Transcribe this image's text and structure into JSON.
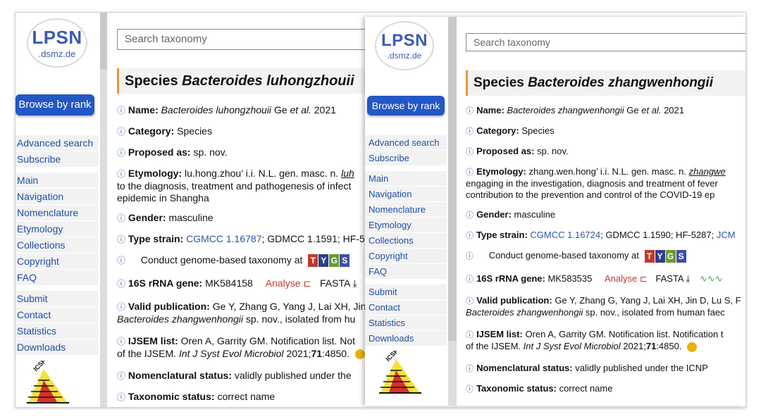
{
  "logo": {
    "name": "LPSN",
    "domain": ".dsmz.de"
  },
  "sidebar": {
    "browse_button": "Browse by rank",
    "items": [
      "Advanced search",
      "Subscribe",
      "Main",
      "Navigation",
      "Nomenclature",
      "Etymology",
      "Collections",
      "Copyright",
      "FAQ",
      "Submit",
      "Contact",
      "Statistics",
      "Downloads"
    ]
  },
  "search": {
    "placeholder": "Search taxonomy"
  },
  "colors": {
    "accent_orange": "#e5963a",
    "link_blue": "#2c56a8",
    "button_blue": "#2257c5",
    "analyse_red": "#c0392b"
  },
  "left": {
    "title_prefix": "Species",
    "title_name": "Bacteroides luhongzhouii",
    "name_label": "Name:",
    "name_value": "Bacteroides luhongzhouii",
    "name_author": "Ge",
    "name_etal": "et al.",
    "name_year": "2021",
    "category_label": "Category:",
    "category_value": "Species",
    "proposed_label": "Proposed as:",
    "proposed_value": "sp. nov.",
    "etymology_label": "Etymology:",
    "etymology_text": "lu.hong.zhou’ i.i. N.L. gen. masc. n.",
    "etymology_trunc": "luh",
    "etymology_line2": "to the diagnosis, treatment and pathogenesis of infect",
    "etymology_line3": "epidemic in Shangha",
    "gender_label": "Gender:",
    "gender_value": "masculine",
    "type_strain_label": "Type strain:",
    "type_strain_link": "CGMCC 1.16787",
    "type_strain_rest": "; GDMCC 1.1591; HF-5",
    "genome_text": "Conduct genome-based taxonomy at",
    "rrna_label": "16S rRNA gene:",
    "rrna_value": "MK584158",
    "analyse": "Analyse",
    "fasta": "FASTA",
    "valid_label": "Valid publication:",
    "valid_text": "Ge Y, Zhang G, Yang J, Lai XH, Jin",
    "valid_line2_species": "Bacteroides zhangwenhongii",
    "valid_line2_rest": "sp. nov., isolated from hu",
    "ijsem_label": "IJSEM list:",
    "ijsem_text": "Oren A, Garrity GM. Notification list. Not",
    "ijsem_line2a": "of the IJSEM.",
    "ijsem_journal": "Int J Syst Evol Microbiol",
    "ijsem_year": "2021;",
    "ijsem_vol": "71",
    "ijsem_pages": ":4850.",
    "nomen_label": "Nomenclatural status:",
    "nomen_value": "validly published under the",
    "taxo_label": "Taxonomic status:",
    "taxo_value": "correct name"
  },
  "right": {
    "title_prefix": "Species",
    "title_name": "Bacteroides zhangwenhongii",
    "name_label": "Name:",
    "name_value": "Bacteroides zhangwenhongii",
    "name_author": "Ge",
    "name_etal": "et al.",
    "name_year": "2021",
    "category_label": "Category:",
    "category_value": "Species",
    "proposed_label": "Proposed as:",
    "proposed_value": "sp. nov.",
    "etymology_label": "Etymology:",
    "etymology_text": "zhang.wen.hong’ i.i. N.L. gen. masc. n.",
    "etymology_trunc": "zhangwe",
    "etymology_line2": "engaging in the investigation, diagnosis and treatment of fever",
    "etymology_line3": "contribution to the prevention and control of the COVID-19 ep",
    "gender_label": "Gender:",
    "gender_value": "masculine",
    "type_strain_label": "Type strain:",
    "type_strain_link": "CGMCC 1.16724",
    "type_strain_rest": "; GDMCC 1.1590; HF-5287;",
    "type_strain_link2": "JCM",
    "genome_text": "Conduct genome-based taxonomy at",
    "rrna_label": "16S rRNA gene:",
    "rrna_value": "MK583535",
    "analyse": "Analyse",
    "fasta": "FASTA",
    "valid_label": "Valid publication:",
    "valid_text": "Ge Y, Zhang G, Yang J, Lai XH, Jin D, Lu S, F",
    "valid_line2_species": "Bacteroides zhangwenhongii",
    "valid_line2_rest": "sp. nov., isolated from human faec",
    "ijsem_label": "IJSEM list:",
    "ijsem_text": "Oren A, Garrity GM. Notification list. Notification t",
    "ijsem_line2a": "of the IJSEM.",
    "ijsem_journal": "Int J Syst Evol Microbiol",
    "ijsem_year": "2021;",
    "ijsem_vol": "71",
    "ijsem_pages": ":4850.",
    "nomen_label": "Nomenclatural status:",
    "nomen_value": "validly published under the ICNP",
    "taxo_label": "Taxonomic status:",
    "taxo_value": "correct name"
  },
  "tygs_letters": [
    "T",
    "Y",
    "G",
    "S"
  ],
  "icons": {
    "info": "info-icon",
    "analyse": "analyse-icon",
    "download": "download-icon",
    "badge": "altmetric-badge-icon",
    "icsp": "icsp-logo"
  }
}
